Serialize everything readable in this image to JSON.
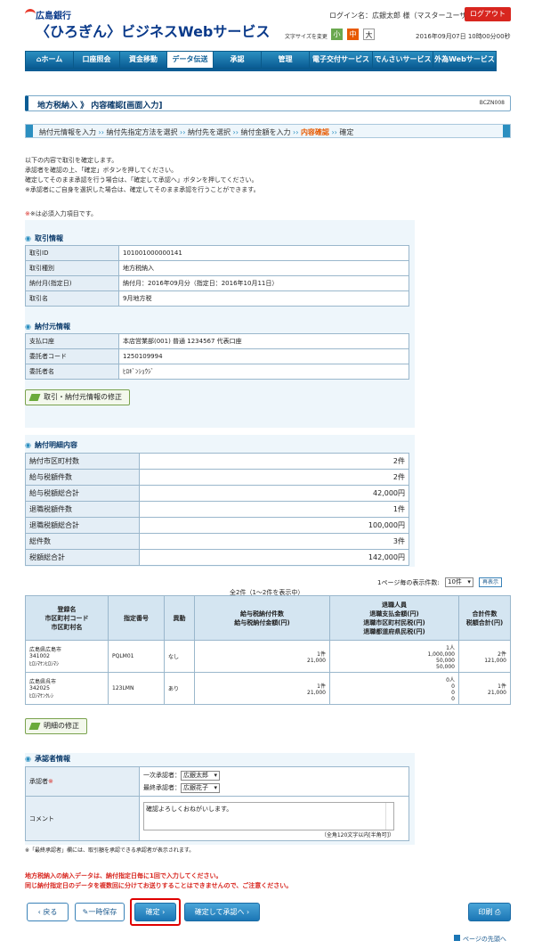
{
  "header": {
    "bank_name": "広島銀行",
    "service_name": "〈ひろぎん〉ビジネスWebサービス",
    "login_label": "ログイン名：広銀太郎 様（マスターユーザ）",
    "logout": "ログアウト",
    "font_size_label": "文字サイズを変更",
    "font_small": "小",
    "font_medium": "中",
    "font_large": "大",
    "datetime": "2016年09月07日 10時00分00秒"
  },
  "nav": [
    "ホーム",
    "口座照会",
    "資金移動",
    "データ伝送",
    "承認",
    "管理",
    "電子交付サービス",
    "でんさいサービス",
    "外為Webサービス"
  ],
  "page": {
    "title": "地方税納入 》 内容確認[画面入力]",
    "screen_id": "BCZN008",
    "steps": [
      "納付元情報を入力",
      "納付先指定方法を選択",
      "納付先を選択",
      "納付金額を入力",
      "内容確認",
      "確定"
    ],
    "intro": [
      "以下の内容で取引を確定します。",
      "承認者を確認の上、「確定」ボタンを押してください。",
      "確定してそのまま承認を行う場合は、「確定して承認へ」ボタンを押してください。",
      "※承認者にご自身を選択した場合は、確定してそのまま承認を行うことができます。"
    ],
    "required_note": "※は必須入力項目です。"
  },
  "trade": {
    "heading": "取引情報",
    "rows": [
      {
        "k": "取引ID",
        "v": "101001000000141"
      },
      {
        "k": "取引種別",
        "v": "地方税納入"
      },
      {
        "k": "納付月(指定日)",
        "v": "納付月：2016年09月分（指定日：2016年10月11日）"
      },
      {
        "k": "取引名",
        "v": "9月地方税"
      }
    ]
  },
  "payer": {
    "heading": "納付元情報",
    "rows": [
      {
        "k": "支払口座",
        "v": "本店営業部(001) 普通 1234567 代表口座"
      },
      {
        "k": "委託者コード",
        "v": "1250109994"
      },
      {
        "k": "委託者名",
        "v": "ﾋﾛｷﾞﾝｼｮｳｼﾞ"
      }
    ],
    "fix_button": "取引・納付元情報の修正"
  },
  "summary": {
    "heading": "納付明細内容",
    "rows": [
      {
        "k": "納付市区町村数",
        "v": "2件"
      },
      {
        "k": "給与税額件数",
        "v": "2件"
      },
      {
        "k": "給与税額総合計",
        "v": "42,000円"
      },
      {
        "k": "退職税額件数",
        "v": "1件"
      },
      {
        "k": "退職税額総合計",
        "v": "100,000円"
      },
      {
        "k": "総件数",
        "v": "3件"
      },
      {
        "k": "税額総合計",
        "v": "142,000円"
      }
    ]
  },
  "detail": {
    "per_page_label": "1ページ毎の表示件数:",
    "per_page_value": "10件",
    "redisplay": "再表示",
    "count_label": "全2件（1〜2件を表示中）",
    "headers": [
      "登録名\n市区町村コード\n市区町村名",
      "指定番号",
      "異動",
      "給与税納付件数\n給与税納付金額(円)",
      "退職人員\n退職支払金額(円)\n退職市区町村民税(円)\n退職都道府県民税(円)",
      "合計件数\n税額合計(円)"
    ],
    "rows": [
      {
        "name": "広島県広島市\n341002\nﾋﾛｼﾏｹﾝﾋﾛｼﾏｼ",
        "num": "PQLM01",
        "change": "なし",
        "salary": "1件\n21,000",
        "retire": "1人\n1,000,000\n50,000\n50,000",
        "total": "2件\n121,000"
      },
      {
        "name": "広島県呉市\n342025\nﾋﾛｼﾏｹﾝｸﾚｼ",
        "num": "123LMN",
        "change": "あり",
        "salary": "1件\n21,000",
        "retire": "0人\n0\n0\n0",
        "total": "1件\n21,000"
      }
    ],
    "fix_button": "明細の修正"
  },
  "approver": {
    "heading": "承認者情報",
    "label": "承認者",
    "req": "※",
    "first_label": "一次承認者：",
    "first_value": "広銀太郎",
    "final_label": "最終承認者：",
    "final_value": "広銀花子",
    "comment_label": "コメント",
    "comment_value": "確認よろしくおねがいします。",
    "comment_hint": "（全角120文字以内[半角可]）",
    "note": "※「最終承認者」欄には、取引額を承認できる承認者が表示されます。"
  },
  "warning": [
    "地方税納入の納入データは、納付指定日毎に1回で入力してください。",
    "同じ納付指定日のデータを複数回に分けてお送りすることはできませんので、ご注意ください。"
  ],
  "buttons": {
    "back": "戻る",
    "save": "一時保存",
    "confirm": "確定",
    "confirm_approve": "確定して承認へ",
    "print": "印刷",
    "page_top": "ページの先頭へ"
  }
}
